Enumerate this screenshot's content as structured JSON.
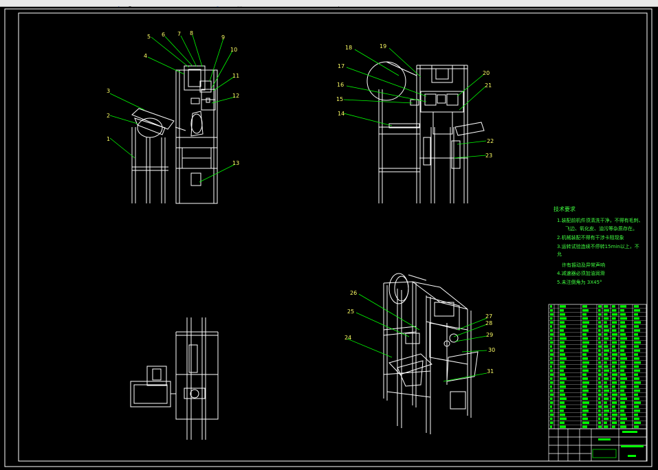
{
  "app": {
    "toolbar_icons": [
      "arrow-icon",
      "zoom-icon",
      "pan-icon",
      "layer-icon",
      "refresh-icon",
      "properties-icon",
      "cursor-icon"
    ]
  },
  "drawing": {
    "background_color": "#000000",
    "frame_color": "#ffffff",
    "leader_color": "#00ff00",
    "label_color": "#ffff66",
    "text_color": "#40ff40",
    "part_numbers": [
      "1",
      "2",
      "3",
      "4",
      "5",
      "6",
      "7",
      "8",
      "9",
      "10",
      "11",
      "12",
      "13",
      "14",
      "15",
      "16",
      "17",
      "18",
      "19",
      "20",
      "21",
      "22",
      "23",
      "24",
      "25",
      "26",
      "27",
      "28",
      "29",
      "30",
      "31"
    ],
    "tech_requirements": {
      "title": "技术要求",
      "lines": [
        "1.装配前机件须清洗干净，不得有毛刺、",
        "飞边、氧化皮、油污等杂质存在。",
        "2.机械装配不得有干涉卡阻现象",
        "3.运转试验连续不停转15min以上，不",
        "允",
        "许有振动及异常声响",
        "4.减速器必须加油润滑",
        "5.未注倒角为 3X45°"
      ]
    }
  }
}
